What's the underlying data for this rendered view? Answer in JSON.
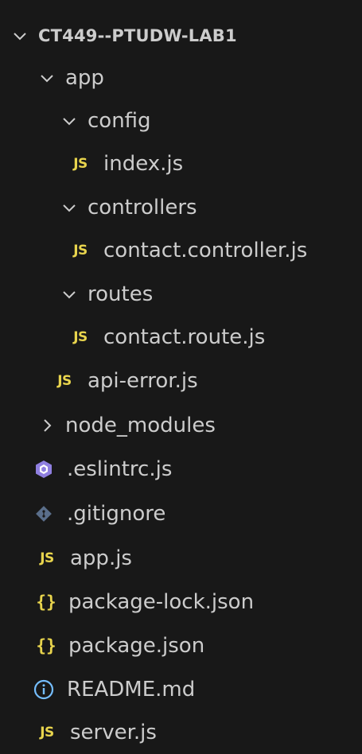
{
  "explorer": {
    "root": {
      "label": "CT449--PTUDW-LAB1",
      "expanded": true
    },
    "items": [
      {
        "label": "app",
        "type": "folder",
        "expanded": true
      },
      {
        "label": "config",
        "type": "folder",
        "expanded": true
      },
      {
        "label": "index.js",
        "type": "file",
        "icon": "js-icon",
        "icon_text": "JS"
      },
      {
        "label": "controllers",
        "type": "folder",
        "expanded": true
      },
      {
        "label": "contact.controller.js",
        "type": "file",
        "icon": "js-icon",
        "icon_text": "JS"
      },
      {
        "label": "routes",
        "type": "folder",
        "expanded": true
      },
      {
        "label": "contact.route.js",
        "type": "file",
        "icon": "js-icon",
        "icon_text": "JS"
      },
      {
        "label": "api-error.js",
        "type": "file",
        "icon": "js-icon",
        "icon_text": "JS"
      },
      {
        "label": "node_modules",
        "type": "folder",
        "expanded": false
      },
      {
        "label": ".eslintrc.js",
        "type": "file",
        "icon": "eslint-icon"
      },
      {
        "label": ".gitignore",
        "type": "file",
        "icon": "git-icon"
      },
      {
        "label": "app.js",
        "type": "file",
        "icon": "js-icon",
        "icon_text": "JS"
      },
      {
        "label": "package-lock.json",
        "type": "file",
        "icon": "json-icon",
        "icon_text": "{}"
      },
      {
        "label": "package.json",
        "type": "file",
        "icon": "json-icon",
        "icon_text": "{}"
      },
      {
        "label": "README.md",
        "type": "file",
        "icon": "info-icon"
      },
      {
        "label": "server.js",
        "type": "file",
        "icon": "js-icon",
        "icon_text": "JS"
      }
    ]
  },
  "colors": {
    "background": "#181818",
    "text": "#cccccc",
    "js": "#e8d44d",
    "json": "#e8d44d",
    "eslint": "#8f7fe0",
    "git": "#5a6e8a",
    "info": "#75beff"
  }
}
